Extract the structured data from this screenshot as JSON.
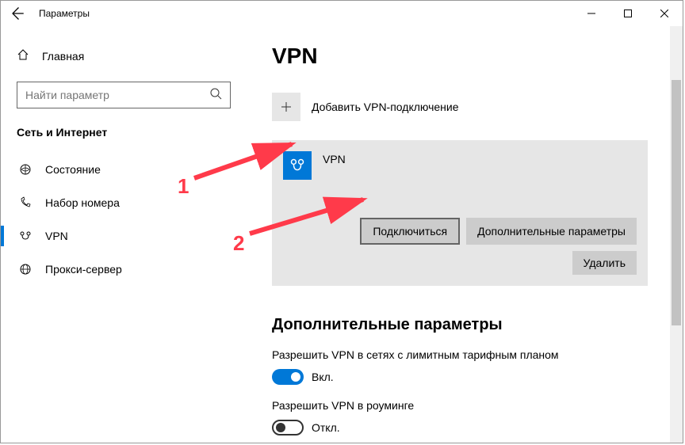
{
  "window": {
    "title": "Параметры"
  },
  "sidebar": {
    "home": "Главная",
    "search_placeholder": "Найти параметр",
    "category": "Сеть и Интернет",
    "items": [
      {
        "label": "Состояние"
      },
      {
        "label": "Набор номера"
      },
      {
        "label": "VPN"
      },
      {
        "label": "Прокси-сервер"
      }
    ]
  },
  "main": {
    "title": "VPN",
    "add_label": "Добавить VPN-подключение",
    "vpn": {
      "name": "VPN",
      "connect": "Подключиться",
      "advanced": "Дополнительные параметры",
      "delete": "Удалить"
    },
    "advanced_section": {
      "title": "Дополнительные параметры",
      "metered_label": "Разрешить VPN в сетях с лимитным тарифным планом",
      "metered_state": "Вкл.",
      "roaming_label": "Разрешить VPN в роуминге",
      "roaming_state": "Откл."
    }
  },
  "annotations": {
    "n1": "1",
    "n2": "2"
  }
}
